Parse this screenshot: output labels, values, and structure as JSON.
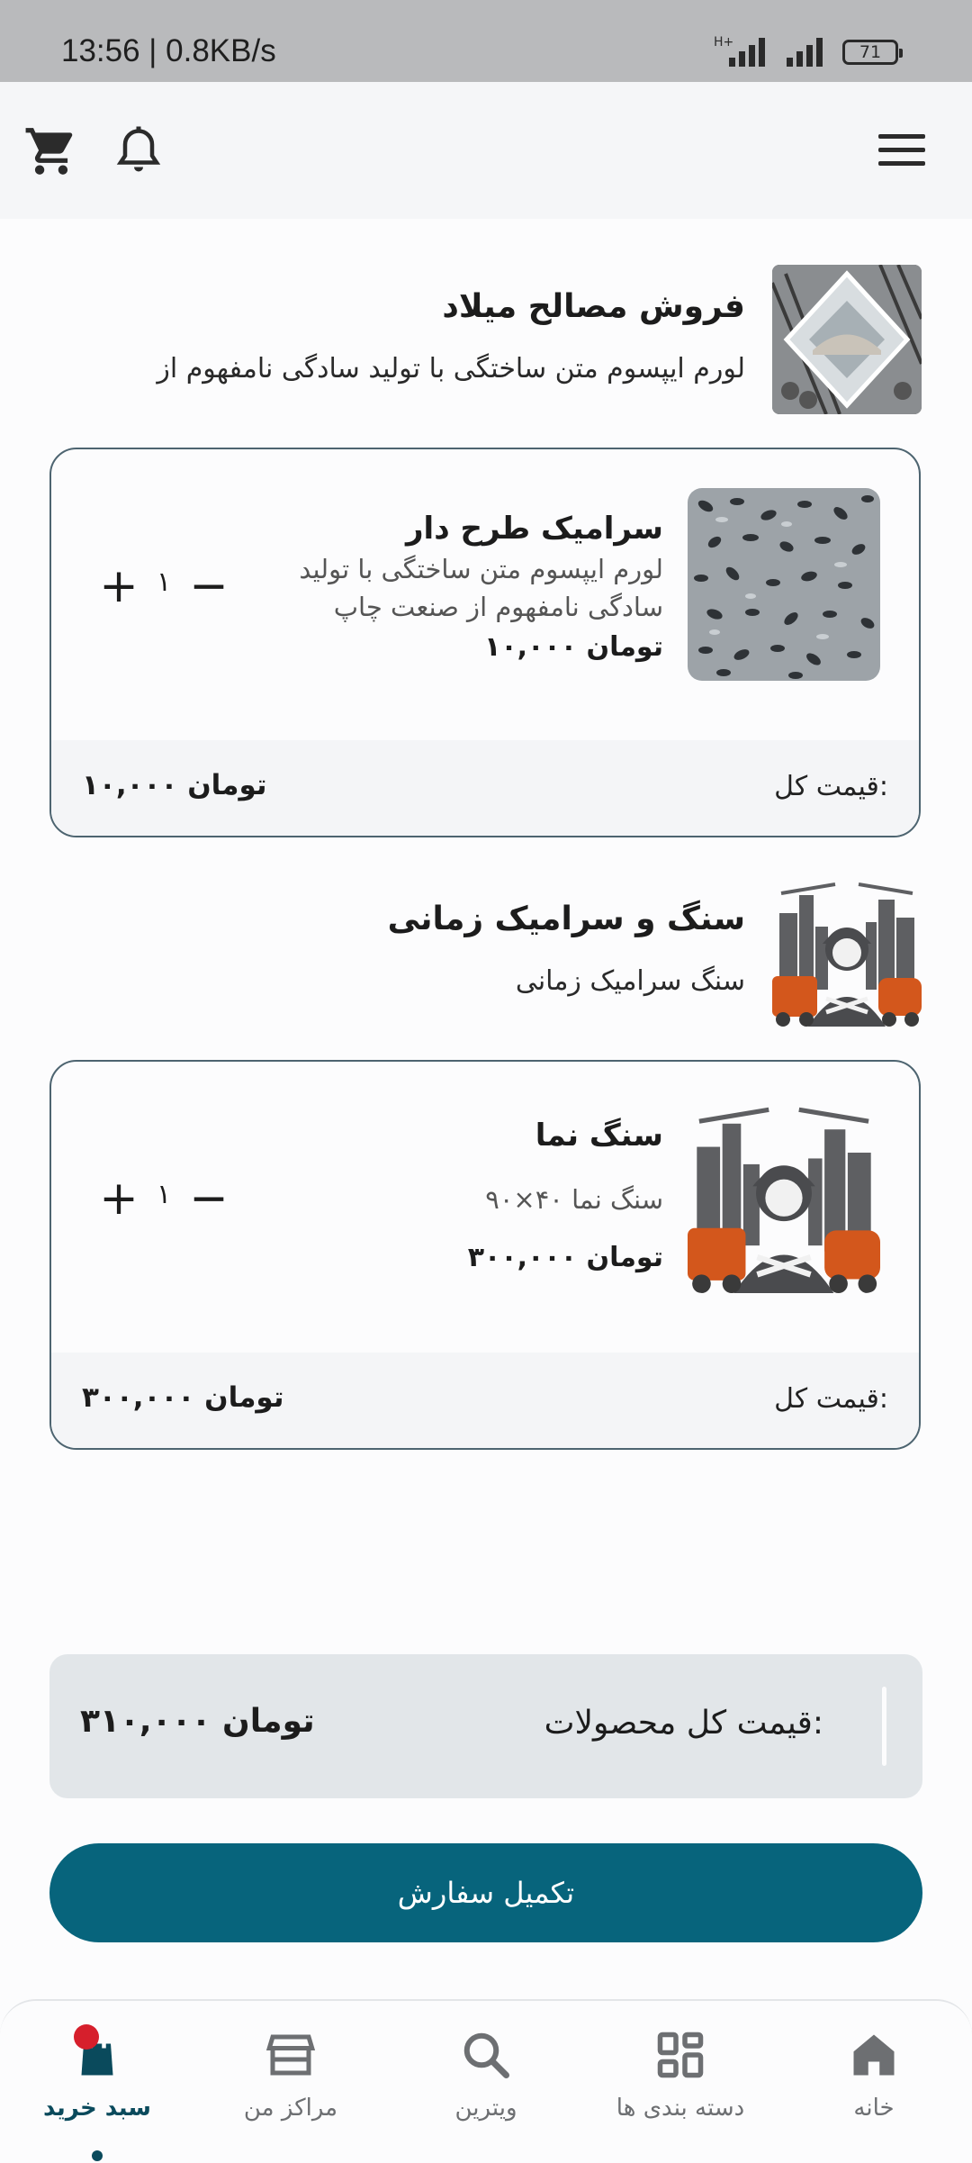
{
  "status_bar": {
    "time": "13:56 | 0.8KB/s",
    "network": "H+",
    "battery": "71"
  },
  "stores": [
    {
      "name": "فروش مصالح میلاد",
      "description": "لورم ایپسوم متن ساختگی با تولید سادگی نامفهوم از",
      "items": [
        {
          "title": "سرامیک طرح دار",
          "description": "لورم ایپسوم متن ساختگی با تولید سادگی نامفهوم از صنعت چاپ",
          "price": "۱۰,۰۰۰ تومان",
          "quantity": "۱",
          "total_label": "قیمت کل:",
          "total_value": "۱۰,۰۰۰ تومان"
        }
      ]
    },
    {
      "name": "سنگ و سرامیک زمانی",
      "description": "سنگ سرامیک زمانی",
      "items": [
        {
          "title": "سنگ نما",
          "description": "سنگ نما ۴۰×۹۰",
          "price": "۳۰۰,۰۰۰ تومان",
          "quantity": "۱",
          "total_label": "قیمت کل:",
          "total_value": "۳۰۰,۰۰۰ تومان"
        }
      ]
    }
  ],
  "summary": {
    "label": "قیمت کل محصولات:",
    "value": "۳۱۰,۰۰۰ تومان"
  },
  "checkout_label": "تکمیل سفارش",
  "bottom_nav": [
    {
      "label": "خانه",
      "icon": "home-icon"
    },
    {
      "label": "دسته بندی ها",
      "icon": "grid-icon"
    },
    {
      "label": "ویترین",
      "icon": "search-icon"
    },
    {
      "label": "مراکز من",
      "icon": "store-icon"
    },
    {
      "label": "سبد خرید",
      "icon": "bag-icon",
      "active": true
    }
  ],
  "colors": {
    "primary": "#07647c",
    "badge": "#d61f2c",
    "card_border": "#4d6470"
  }
}
